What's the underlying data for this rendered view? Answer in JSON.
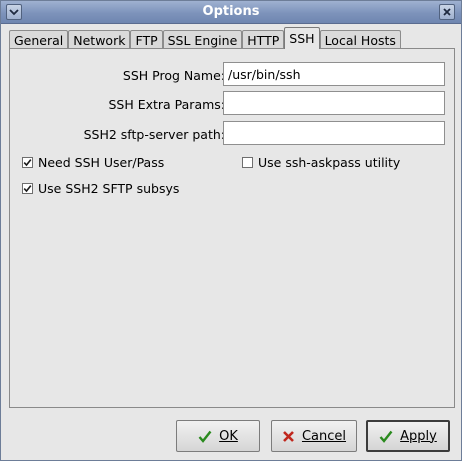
{
  "window": {
    "title": "Options"
  },
  "tabs": [
    {
      "label": "General"
    },
    {
      "label": "Network"
    },
    {
      "label": "FTP"
    },
    {
      "label": "SSL Engine"
    },
    {
      "label": "HTTP"
    },
    {
      "label": "SSH",
      "active": true
    },
    {
      "label": "Local Hosts"
    }
  ],
  "ssh": {
    "prog_name_label": "SSH Prog Name:",
    "prog_name_value": "/usr/bin/ssh",
    "extra_params_label": "SSH Extra Params:",
    "extra_params_value": "",
    "sftp_path_label": "SSH2 sftp-server path:",
    "sftp_path_value": "",
    "need_user_pass": {
      "label": "Need SSH User/Pass",
      "checked": true
    },
    "askpass": {
      "label": "Use ssh-askpass utility",
      "checked": false
    },
    "sftp_subsys": {
      "label": "Use SSH2 SFTP subsys",
      "checked": true
    }
  },
  "buttons": {
    "ok": {
      "label": "OK",
      "icon": "check-icon"
    },
    "cancel": {
      "label": "Cancel",
      "icon": "cross-icon"
    },
    "apply": {
      "label": "Apply",
      "icon": "check-icon"
    }
  }
}
